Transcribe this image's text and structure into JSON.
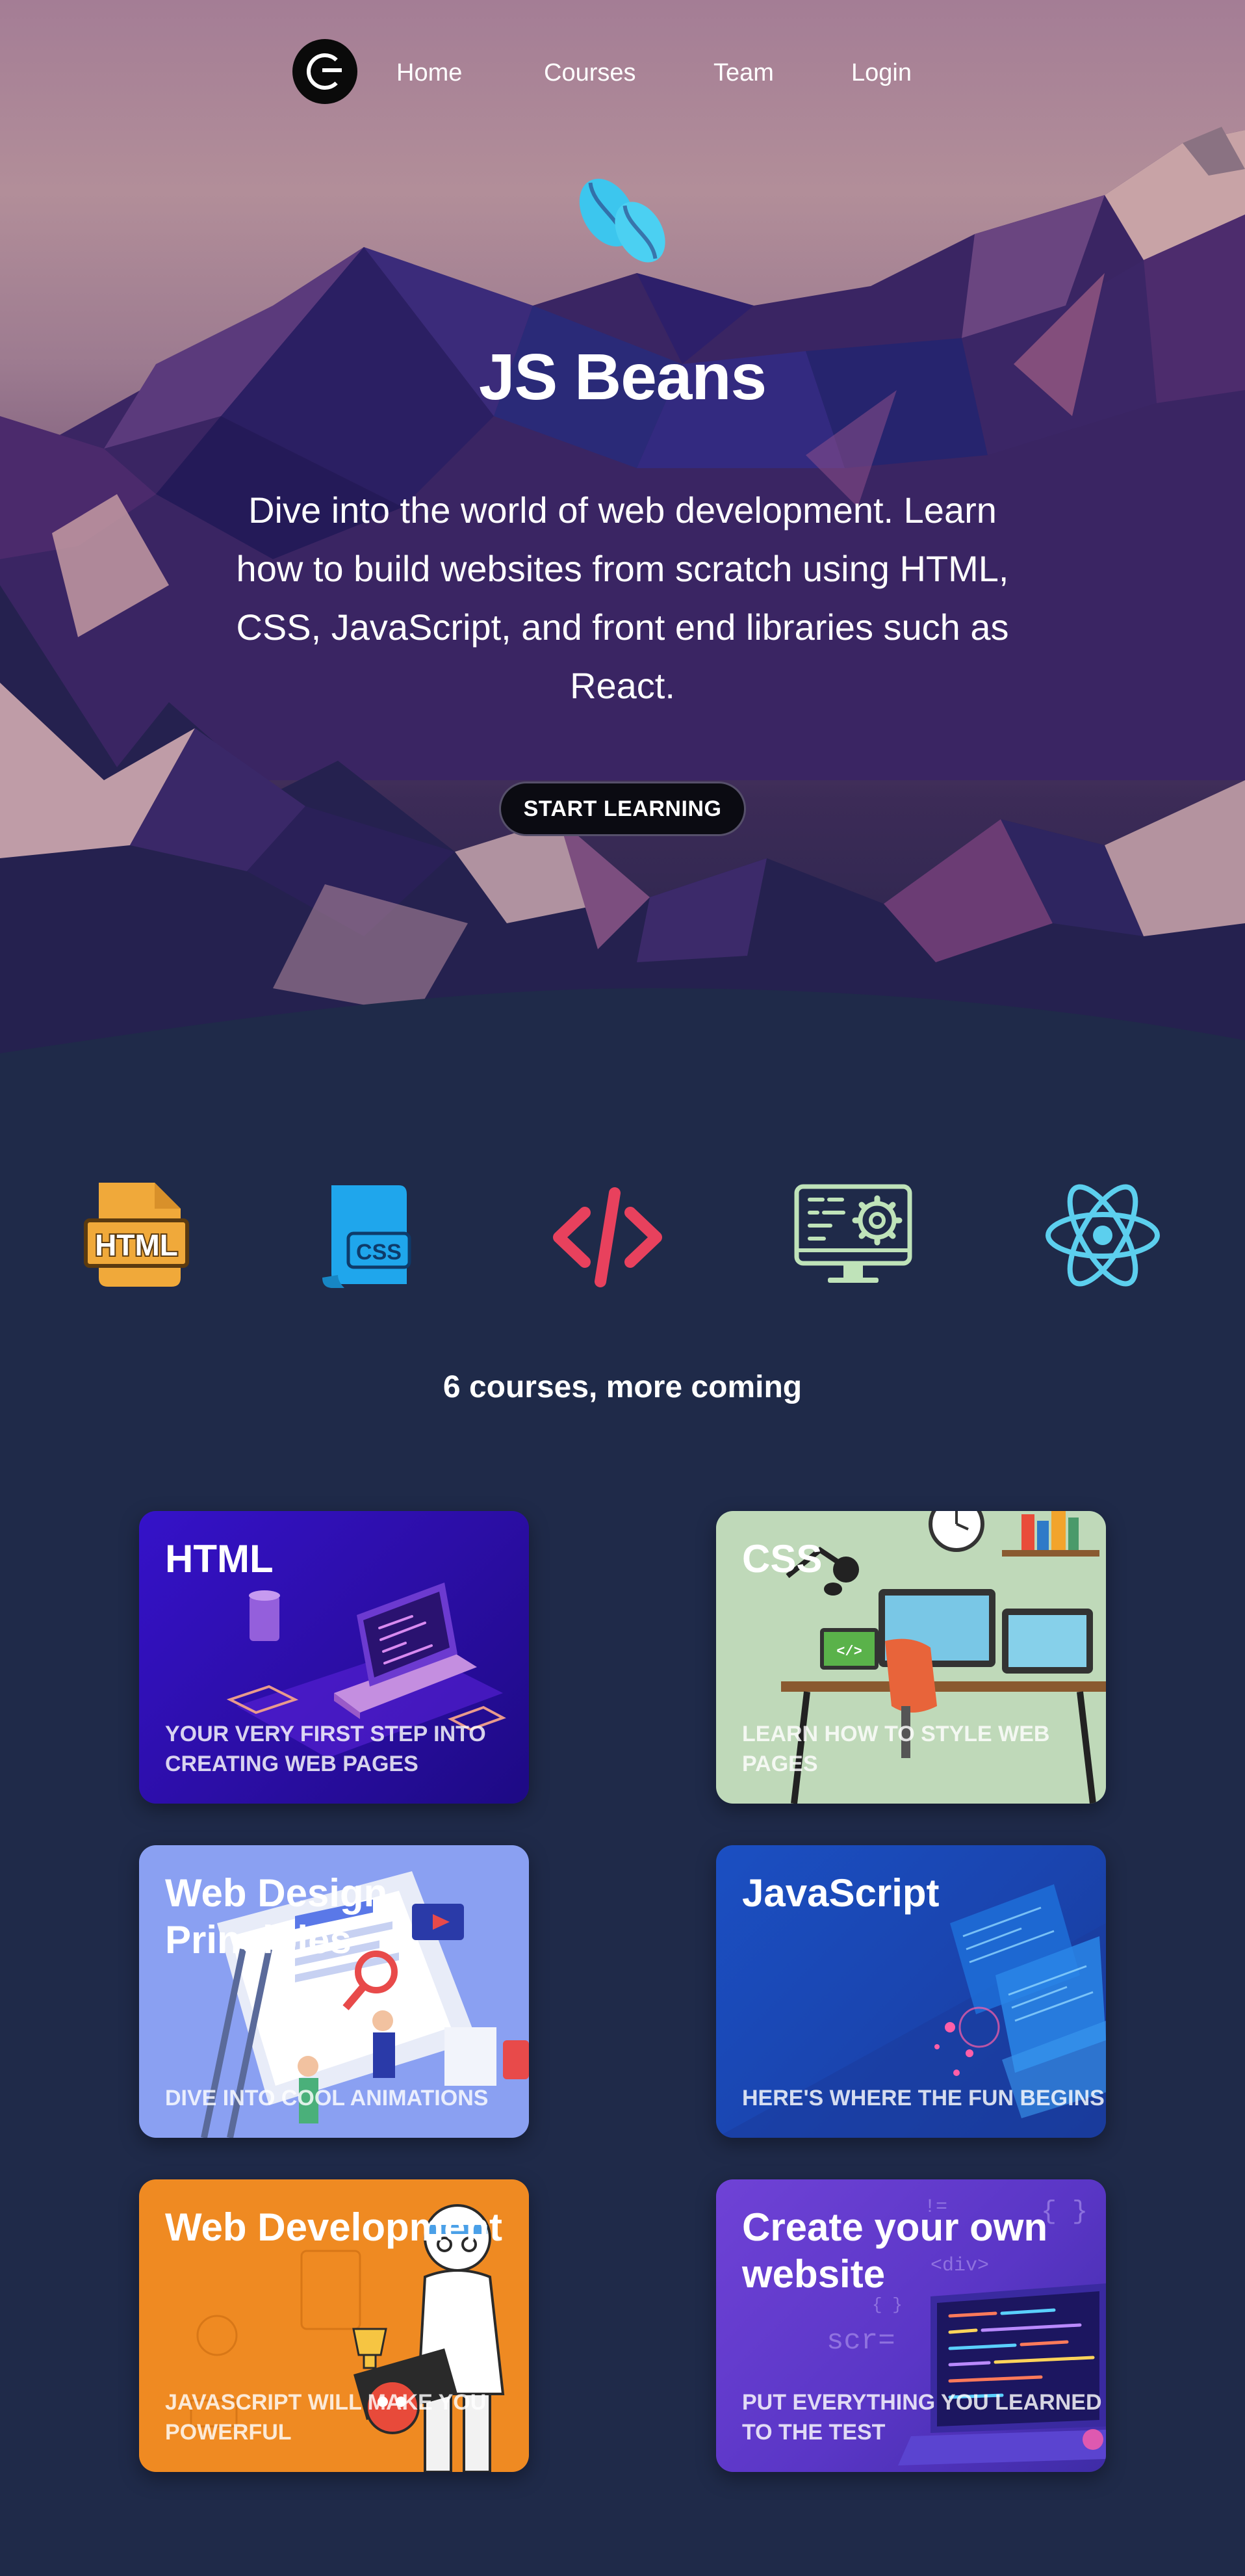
{
  "nav": {
    "logo_icon": "coffee-bean-logo-icon",
    "items": [
      {
        "label": "Home"
      },
      {
        "label": "Courses"
      },
      {
        "label": "Team"
      },
      {
        "label": "Login"
      }
    ]
  },
  "hero": {
    "icon": "coffee-beans-icon",
    "title": "JS Beans",
    "description": "Dive into the world of web development. Learn how to build websites from scratch using HTML, CSS, JavaScript, and front end libraries such as React.",
    "cta_label": "START LEARNING"
  },
  "tech_icons": [
    {
      "name": "html-file-icon",
      "color": "#f0a93a"
    },
    {
      "name": "css-scroll-icon",
      "color": "#1fa6ec"
    },
    {
      "name": "code-brackets-icon",
      "color": "#e8415d"
    },
    {
      "name": "monitor-gear-icon",
      "color": "#bfe3b9"
    },
    {
      "name": "react-atom-icon",
      "color": "#5ccfee"
    }
  ],
  "courses_count_label": "6 courses, more coming",
  "courses": [
    {
      "title": "HTML",
      "subtitle": "Your very first step into creating web pages",
      "accent": "#3512c9"
    },
    {
      "title": "CSS",
      "subtitle": "Learn how to style web pages",
      "accent": "#bfd9b9"
    },
    {
      "title": "Web Design Principles",
      "subtitle": "Dive into cool animations",
      "accent": "#8aa0f2"
    },
    {
      "title": "JavaScript",
      "subtitle": "Here's where the fun begins",
      "accent": "#1b4fc2"
    },
    {
      "title": "Web Development",
      "subtitle": "JavaScript will make you powerful",
      "accent": "#ef8a22"
    },
    {
      "title": "Create your own website",
      "subtitle": "Put everything you learned to the test",
      "accent": "#6f42d6"
    }
  ],
  "colors": {
    "page_background": "#1f2a49",
    "cta_background": "#0b0b12"
  }
}
